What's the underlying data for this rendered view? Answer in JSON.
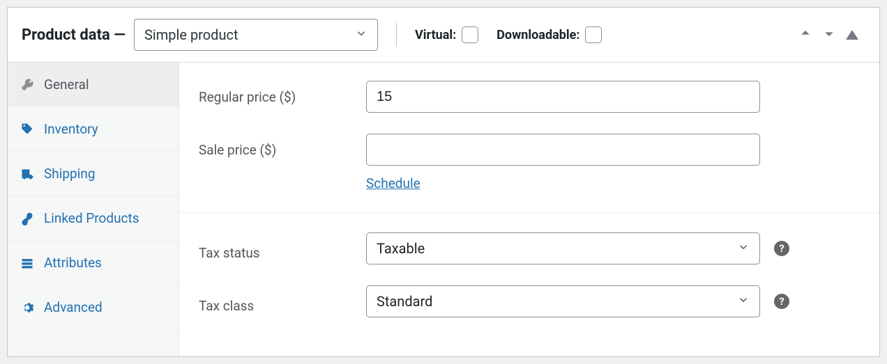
{
  "header": {
    "title": "Product data —",
    "product_type": "Simple product",
    "virtual_label": "Virtual:",
    "downloadable_label": "Downloadable:"
  },
  "sidebar": {
    "items": [
      {
        "label": "General"
      },
      {
        "label": "Inventory"
      },
      {
        "label": "Shipping"
      },
      {
        "label": "Linked Products"
      },
      {
        "label": "Attributes"
      },
      {
        "label": "Advanced"
      }
    ]
  },
  "general": {
    "regular_price_label": "Regular price ($)",
    "regular_price_value": "15",
    "sale_price_label": "Sale price ($)",
    "sale_price_value": "",
    "schedule_label": "Schedule",
    "tax_status_label": "Tax status",
    "tax_status_value": "Taxable",
    "tax_class_label": "Tax class",
    "tax_class_value": "Standard"
  }
}
